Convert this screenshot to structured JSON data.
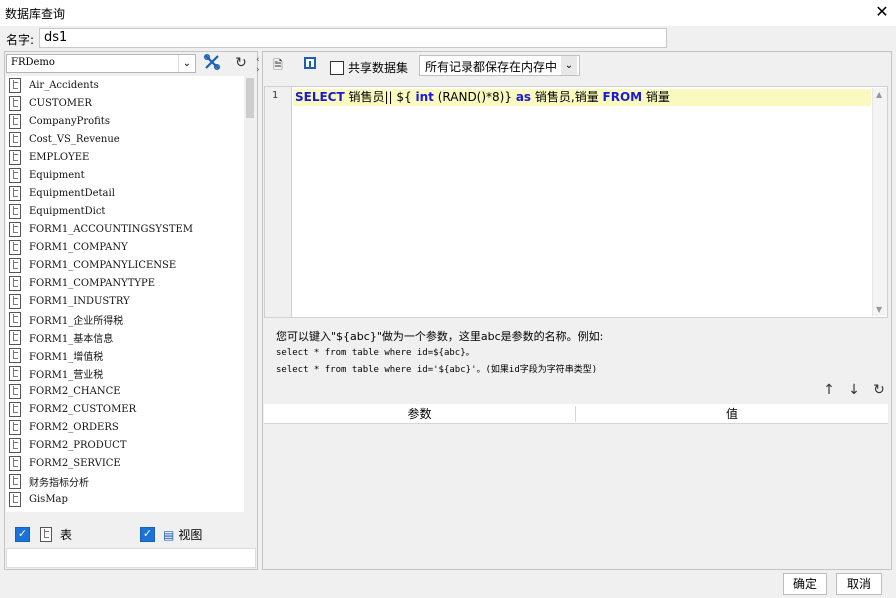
{
  "window": {
    "title": "数据库查询",
    "close_icon": "close-icon"
  },
  "name_field": {
    "label": "名字:",
    "value": "ds1"
  },
  "left_panel": {
    "database": "FRDemo",
    "tables": [
      "Air_Accidents",
      "CUSTOMER",
      "CompanyProfits",
      "Cost_VS_Revenue",
      "EMPLOYEE",
      "Equipment",
      "EquipmentDetail",
      "EquipmentDict",
      "FORM1_ACCOUNTINGSYSTEM",
      "FORM1_COMPANY",
      "FORM1_COMPANYLICENSE",
      "FORM1_COMPANYTYPE",
      "FORM1_INDUSTRY",
      "FORM1_企业所得税",
      "FORM1_基本信息",
      "FORM1_增值税",
      "FORM1_营业税",
      "FORM2_CHANCE",
      "FORM2_CUSTOMER",
      "FORM2_ORDERS",
      "FORM2_PRODUCT",
      "FORM2_SERVICE",
      "财务指标分析",
      "GisMap"
    ],
    "show_tables": {
      "label": "表",
      "checked": true
    },
    "show_views": {
      "label": "视图",
      "checked": true
    }
  },
  "toolbar": {
    "shared_dataset_label": "共享数据集",
    "shared_dataset_checked": false,
    "memory_mode": "所有记录都保存在内存中"
  },
  "editor": {
    "line_number": "1",
    "sql_tokens": [
      {
        "t": "SELECT",
        "kw": true
      },
      {
        "t": " 销售员|| ${ ",
        "kw": false
      },
      {
        "t": "int",
        "kw": true
      },
      {
        "t": " (RAND()*8)} ",
        "kw": false
      },
      {
        "t": "as",
        "kw": true
      },
      {
        "t": " 销售员,销量 ",
        "kw": false
      },
      {
        "t": "FROM",
        "kw": true
      },
      {
        "t": " 销量",
        "kw": false
      }
    ]
  },
  "hint": {
    "line1": "您可以键入\"${abc}\"做为一个参数，这里abc是参数的名称。例如:",
    "line2": "select * from table where id=${abc}。",
    "line3": "select * from table where id='${abc}'。(如果id字段为字符串类型)"
  },
  "param_table": {
    "columns": [
      "参数",
      "值"
    ]
  },
  "footer": {
    "ok": "确定",
    "cancel": "取消"
  }
}
